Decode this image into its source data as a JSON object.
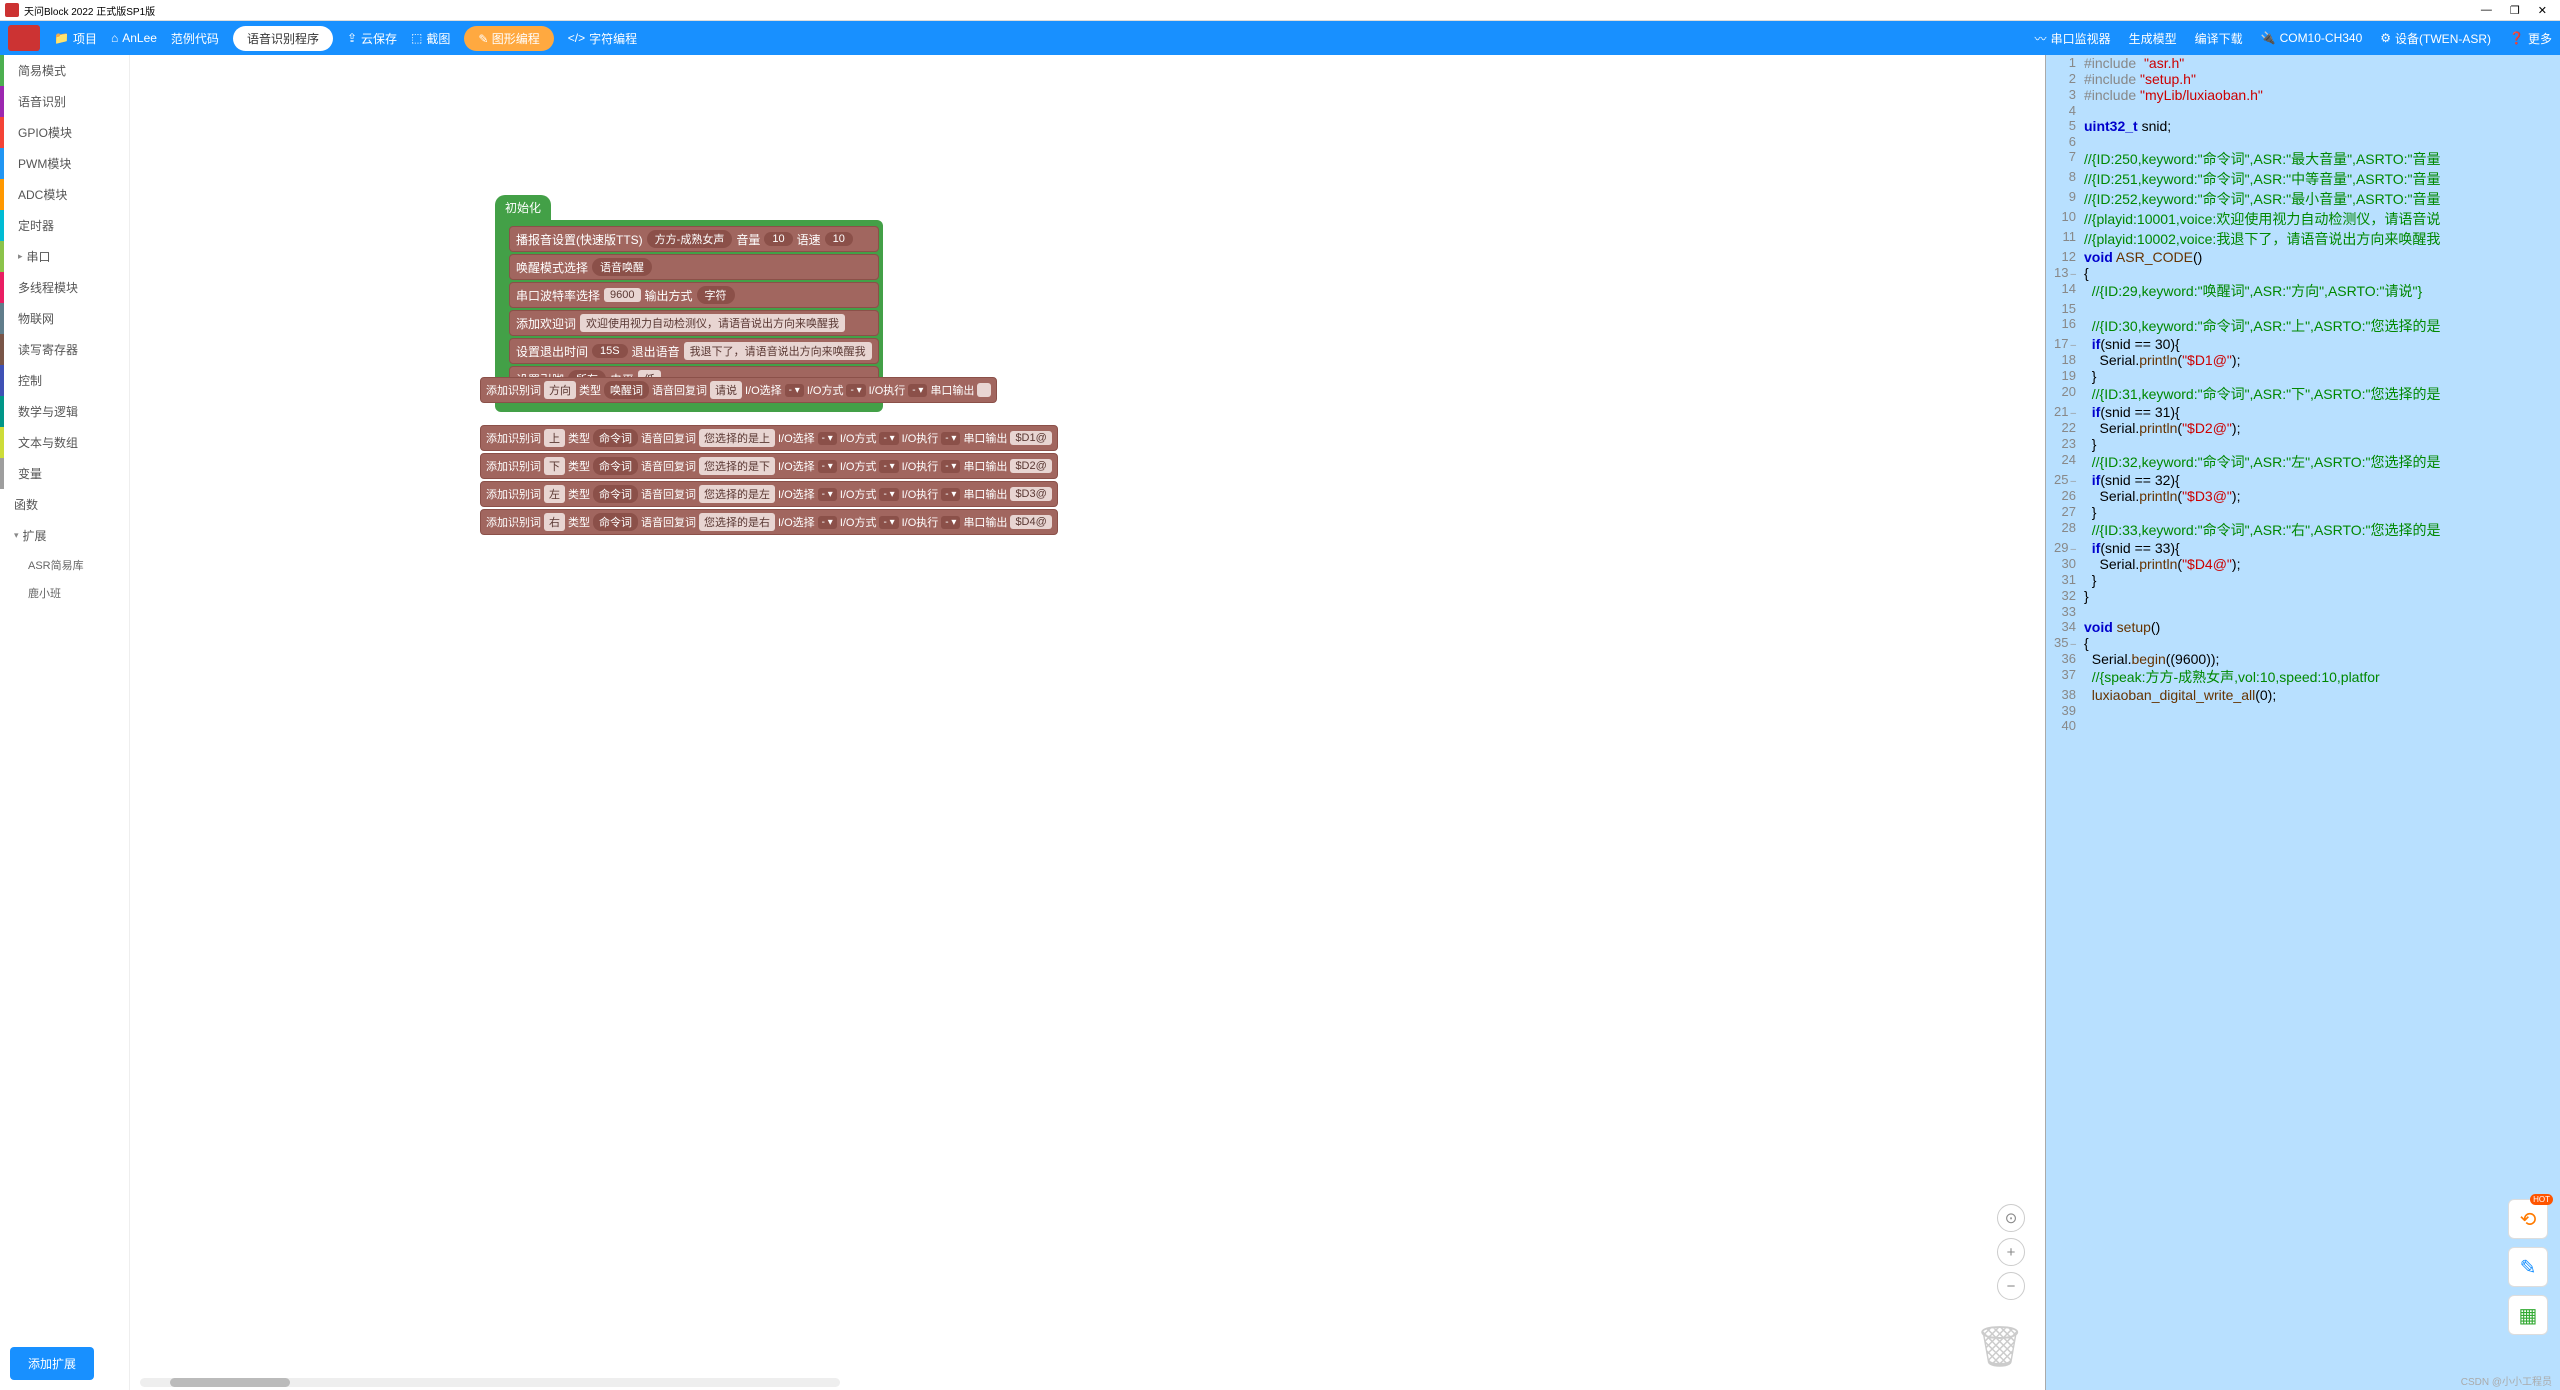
{
  "window": {
    "title": "天问Block 2022 正式版SP1版"
  },
  "toolbar": {
    "project": "项目",
    "user": "AnLee",
    "sample": "范例代码",
    "program_name": "语音识别程序",
    "cloud_save": "云保存",
    "screenshot": "截图",
    "graphic_prog": "图形编程",
    "char_prog": "字符编程",
    "serial_monitor": "串口监视器",
    "gen_model": "生成模型",
    "compile_dl": "编译下载",
    "port": "COM10-CH340",
    "device": "设备(TWEN-ASR)",
    "more": "更多"
  },
  "sidebar": {
    "items": [
      "简易模式",
      "语音识别",
      "GPIO模块",
      "PWM模块",
      "ADC模块",
      "定时器",
      "串口",
      "多线程模块",
      "物联网",
      "读写寄存器",
      "控制",
      "数学与逻辑",
      "文本与数组",
      "变量",
      "函数",
      "扩展"
    ],
    "subs": [
      "ASR简易库",
      "鹿小班"
    ],
    "add_ext": "添加扩展"
  },
  "blocks": {
    "init": "初始化",
    "tts_label": "播报音设置(快速版TTS)",
    "tts_voice": "方方-成熟女声",
    "vol_label": "音量",
    "vol_val": "10",
    "speed_label": "语速",
    "speed_val": "10",
    "wake_label": "唤醒模式选择",
    "wake_val": "语音唤醒",
    "baud_label": "串口波特率选择",
    "baud_val": "9600",
    "out_label": "输出方式",
    "out_val": "字符",
    "welcome_label": "添加欢迎词",
    "welcome_val": "欢迎使用视力自动检测仪，请语音说出方向来唤醒我",
    "exit_label": "设置退出时间",
    "exit_val": "15S",
    "exit_voice_label": "退出语音",
    "exit_voice_val": "我退下了，请语音说出方向来唤醒我",
    "pin_label": "设置引脚",
    "pin_all": "所有",
    "pin_level": "电平",
    "pin_low": "低",
    "rec_label": "添加识别词",
    "type_label": "类型",
    "wake_word": "唤醒词",
    "cmd_word": "命令词",
    "reply_label": "语音回复词",
    "io_sel": "I/O选择",
    "io_mode": "I/O方式",
    "io_exec": "I/O执行",
    "serial_out": "串口输出",
    "row0": {
      "word": "方向",
      "type": "唤醒词",
      "reply": "请说"
    },
    "rows": [
      {
        "word": "上",
        "reply": "您选择的是上",
        "out": "$D1@"
      },
      {
        "word": "下",
        "reply": "您选择的是下",
        "out": "$D2@"
      },
      {
        "word": "左",
        "reply": "您选择的是左",
        "out": "$D3@"
      },
      {
        "word": "右",
        "reply": "您选择的是右",
        "out": "$D4@"
      }
    ]
  },
  "code": {
    "lines": [
      {
        "n": 1,
        "html": "<span class='pre'>#include</span>  <span class='str'>\"asr.h\"</span>"
      },
      {
        "n": 2,
        "html": "<span class='pre'>#include</span> <span class='str'>\"setup.h\"</span>"
      },
      {
        "n": 3,
        "html": "<span class='pre'>#include</span> <span class='str'>\"myLib/luxiaoban.h\"</span>"
      },
      {
        "n": 4,
        "html": ""
      },
      {
        "n": 5,
        "html": "<span class='typ'>uint32_t</span> snid;"
      },
      {
        "n": 6,
        "html": ""
      },
      {
        "n": 7,
        "html": "<span class='cmt'>//{ID:250,keyword:\"命令词\",ASR:\"最大音量\",ASRTO:\"音量</span>"
      },
      {
        "n": 8,
        "html": "<span class='cmt'>//{ID:251,keyword:\"命令词\",ASR:\"中等音量\",ASRTO:\"音量</span>"
      },
      {
        "n": 9,
        "html": "<span class='cmt'>//{ID:252,keyword:\"命令词\",ASR:\"最小音量\",ASRTO:\"音量</span>"
      },
      {
        "n": 10,
        "html": "<span class='cmt'>//{playid:10001,voice:欢迎使用视力自动检测仪，请语音说</span>"
      },
      {
        "n": 11,
        "html": "<span class='cmt'>//{playid:10002,voice:我退下了，请语音说出方向来唤醒我</span>"
      },
      {
        "n": 12,
        "html": "<span class='typ'>void</span> <span class='id'>ASR_CODE</span>()"
      },
      {
        "n": 13,
        "html": "{",
        "fold": true
      },
      {
        "n": 14,
        "html": "  <span class='cmt'>//{ID:29,keyword:\"唤醒词\",ASR:\"方向\",ASRTO:\"请说\"}</span>"
      },
      {
        "n": 15,
        "html": ""
      },
      {
        "n": 16,
        "html": "  <span class='cmt'>//{ID:30,keyword:\"命令词\",ASR:\"上\",ASRTO:\"您选择的是</span>"
      },
      {
        "n": 17,
        "html": "  <span class='kw'>if</span>(snid == 30){",
        "fold": true
      },
      {
        "n": 18,
        "html": "    Serial.<span class='id'>println</span>(<span class='str'>\"$D1@\"</span>);"
      },
      {
        "n": 19,
        "html": "  }"
      },
      {
        "n": 20,
        "html": "  <span class='cmt'>//{ID:31,keyword:\"命令词\",ASR:\"下\",ASRTO:\"您选择的是</span>"
      },
      {
        "n": 21,
        "html": "  <span class='kw'>if</span>(snid == 31){",
        "fold": true
      },
      {
        "n": 22,
        "html": "    Serial.<span class='id'>println</span>(<span class='str'>\"$D2@\"</span>);"
      },
      {
        "n": 23,
        "html": "  }"
      },
      {
        "n": 24,
        "html": "  <span class='cmt'>//{ID:32,keyword:\"命令词\",ASR:\"左\",ASRTO:\"您选择的是</span>"
      },
      {
        "n": 25,
        "html": "  <span class='kw'>if</span>(snid == 32){",
        "fold": true
      },
      {
        "n": 26,
        "html": "    Serial.<span class='id'>println</span>(<span class='str'>\"$D3@\"</span>);"
      },
      {
        "n": 27,
        "html": "  }"
      },
      {
        "n": 28,
        "html": "  <span class='cmt'>//{ID:33,keyword:\"命令词\",ASR:\"右\",ASRTO:\"您选择的是</span>"
      },
      {
        "n": 29,
        "html": "  <span class='kw'>if</span>(snid == 33){",
        "fold": true
      },
      {
        "n": 30,
        "html": "    Serial.<span class='id'>println</span>(<span class='str'>\"$D4@\"</span>);"
      },
      {
        "n": 31,
        "html": "  }"
      },
      {
        "n": 32,
        "html": "}"
      },
      {
        "n": 33,
        "html": ""
      },
      {
        "n": 34,
        "html": "<span class='typ'>void</span> <span class='id'>setup</span>()"
      },
      {
        "n": 35,
        "html": "{",
        "fold": true
      },
      {
        "n": 36,
        "html": "  Serial.<span class='id'>begin</span>((9600));"
      },
      {
        "n": 37,
        "html": "  <span class='cmt'>//{speak:方方-成熟女声,vol:10,speed:10,platfor</span>"
      },
      {
        "n": 38,
        "html": "  <span class='id'>luxiaoban_digital_write_all</span>(0);"
      },
      {
        "n": 39,
        "html": ""
      },
      {
        "n": 40,
        "html": ""
      }
    ]
  },
  "watermark": "CSDN @小小工程员"
}
